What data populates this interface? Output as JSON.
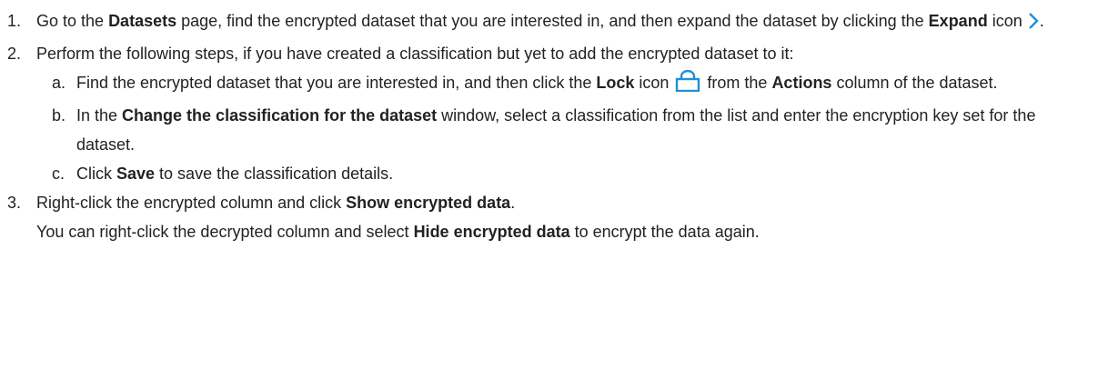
{
  "steps": [
    {
      "num": "1.",
      "t1": "Go to the ",
      "b1": "Datasets",
      "t2": " page, find the encrypted dataset that you are interested in, and then expand the dataset by clicking the ",
      "b2": "Expand",
      "t3": " icon ",
      "t4": ".",
      "icon": "chevron-right-icon"
    },
    {
      "num": "2.",
      "text": "Perform the following steps, if you have created a classification but yet to add the encrypted dataset to it:",
      "substeps": [
        {
          "letter": "a.",
          "t1": "Find the encrypted dataset that you are interested in, and then click the ",
          "b1": "Lock",
          "t2": " icon ",
          "t3": " from the ",
          "b2": "Actions",
          "t4": " column of the dataset.",
          "icon": "lock-icon"
        },
        {
          "letter": "b.",
          "t1": "In the ",
          "b1": "Change the classification for the dataset",
          "t2": " window, select a classification from the list and enter the encryption key set for the dataset."
        },
        {
          "letter": "c.",
          "t1": "Click ",
          "b1": "Save",
          "t2": " to save the classification details."
        }
      ]
    },
    {
      "num": "3.",
      "t1": "Right-click the encrypted column and click ",
      "b1": "Show encrypted data",
      "t2": ".",
      "note": {
        "t1": "You can right-click the decrypted column and select ",
        "b1": "Hide encrypted data",
        "t2": " to encrypt the data again."
      }
    }
  ],
  "colors": {
    "icon_blue": "#1f8fd8",
    "text": "#222222"
  }
}
